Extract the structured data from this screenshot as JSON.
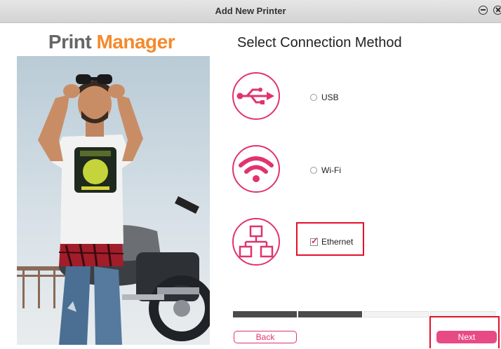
{
  "window": {
    "title": "Add New Printer"
  },
  "logo": {
    "word1": "Print",
    "word2": "Manager"
  },
  "heading": "Select Connection Method",
  "options": [
    {
      "label": "USB",
      "icon": "usb-icon",
      "selected": false
    },
    {
      "label": "Wi-Fi",
      "icon": "wifi-icon",
      "selected": false
    },
    {
      "label": "Ethernet",
      "icon": "ethernet-icon",
      "selected": true
    }
  ],
  "progress": {
    "total_steps": 4,
    "completed_steps": 2
  },
  "buttons": {
    "back": "Back",
    "next": "Next"
  },
  "colors": {
    "accent": "#e0336f",
    "logo_orange": "#f5892c",
    "highlight": "#e0112b"
  }
}
